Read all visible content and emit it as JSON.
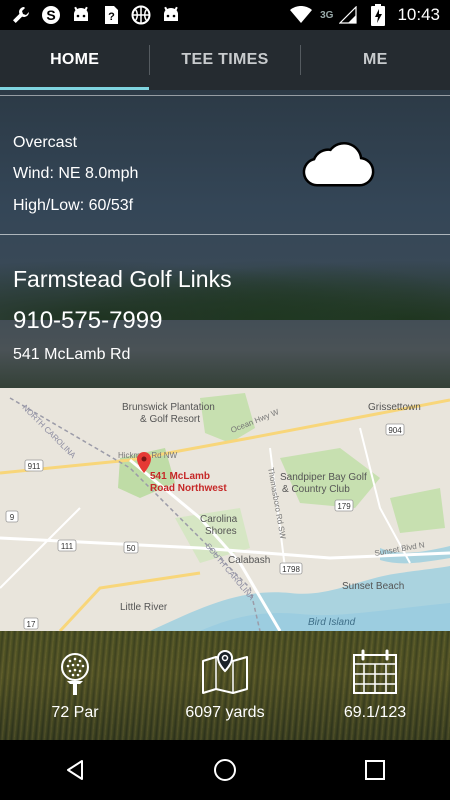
{
  "status_bar": {
    "network": "3G",
    "time": "10:43",
    "notification_icons": [
      "wrench-icon",
      "skype-icon",
      "android-icon",
      "sim-question-icon",
      "basketball-icon",
      "android-icon"
    ]
  },
  "tabs": [
    {
      "label": "HOME",
      "active": true
    },
    {
      "label": "TEE TIMES",
      "active": false
    },
    {
      "label": "ME",
      "active": false
    }
  ],
  "weather": {
    "condition": "Overcast",
    "wind": "Wind: NE 8.0mph",
    "high_low": "High/Low: 60/53f",
    "icon": "cloud-icon"
  },
  "course": {
    "name": "Farmstead Golf Links",
    "phone": "910-575-7999",
    "address": "541 McLamb Rd"
  },
  "map": {
    "pin_label_line1": "541 McLamb",
    "pin_label_line2": "Road Northwest",
    "places": [
      "Brunswick Plantation",
      "& Golf Resort",
      "Grissettown",
      "Sandpiper Bay Golf",
      "& Country Club",
      "Carolina",
      "Shores",
      "Calabash",
      "Sunset Beach",
      "Little River",
      "Bird Island",
      "NORTH CAROLINA",
      "SOUTH CAROLINA",
      "Ocean Hwy W",
      "Hickman Rd NW",
      "Sunset Blvd N",
      "Thomasboro Rd SW"
    ],
    "route_numbers": [
      "904",
      "179",
      "911",
      "111",
      "50",
      "1798",
      "17",
      "9"
    ]
  },
  "stats": {
    "par": "72 Par",
    "yards": "6097 yards",
    "rating": "69.1/123"
  },
  "nav": [
    "back-icon",
    "home-icon",
    "recents-icon"
  ],
  "colors": {
    "tab_indicator": "#7fd4df",
    "status_bar": "#000000",
    "tab_bar": "#252b30",
    "map_pin": "#e53935"
  }
}
